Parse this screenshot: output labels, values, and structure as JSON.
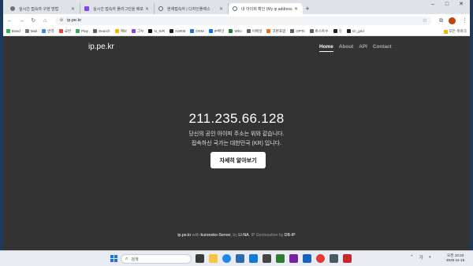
{
  "browser": {
    "tabs": [
      {
        "title": "실시간 접속자 구현 방법",
        "icon": "chrome-icon"
      },
      {
        "title": "실시간 접속자 플러그인을 배포",
        "icon": "purple-app-icon"
      },
      {
        "title": "현재접속자 | 디자인플렉스",
        "icon": "globe-icon"
      },
      {
        "title": "내 아이피 확인 (My ip address",
        "icon": "globe-icon"
      }
    ],
    "new_tab_label": "+",
    "address": "ip.pe.kr",
    "bookmarks": [
      {
        "label": "Band",
        "color": "#2bb24c"
      },
      {
        "label": "Mail",
        "color": "#777777"
      },
      {
        "label": "번역",
        "color": "#4285f4"
      },
      {
        "label": "국번",
        "color": "#ea4335"
      },
      {
        "label": "Play",
        "color": "#34a853"
      },
      {
        "label": "Search",
        "color": "#5f6368"
      },
      {
        "label": "매보",
        "color": "#f4b400"
      },
      {
        "label": "그누",
        "color": "#8a3ffc"
      },
      {
        "label": "N_SIR",
        "color": "#111111"
      },
      {
        "label": "A2008",
        "color": "#222222"
      },
      {
        "label": "DSM",
        "color": "#1a73e8"
      },
      {
        "label": "IP확인",
        "color": "#0d6efd"
      },
      {
        "label": "Who",
        "color": "#188038"
      },
      {
        "label": "이메일",
        "color": "#5f6368"
      },
      {
        "label": "코판포럼",
        "color": "#e8710a"
      },
      {
        "label": "GPTs",
        "color": "#5f6368"
      },
      {
        "label": "토스트수",
        "color": "#5f6368"
      },
      {
        "label": "깃",
        "color": "#202124"
      },
      {
        "label": "GI_grid",
        "color": "#202124"
      }
    ],
    "bookmarks_folder": "모든 북마크"
  },
  "page": {
    "brand": "ip.pe.kr",
    "nav": [
      "Home",
      "About",
      "API",
      "Contact"
    ],
    "ip_address": "211.235.66.128",
    "line1": "당신의 공인 아이피 주소는 위와 같습니다.",
    "line2": "접속하신 국가는 대한민국 (KR) 입니다.",
    "more_button": "자세히 알아보기",
    "footer": {
      "site": "ip.pe.kr",
      "with": " with ",
      "server": "kuroneko-Server",
      "by": ", by ",
      "author": "LI-NA",
      "geo_prefix": ". IP Geolocation by ",
      "geo": "DB-IP"
    }
  },
  "taskbar": {
    "search_placeholder": "검색",
    "tray_lang": "가",
    "time": "오전 10:23",
    "date": "2025-11-15"
  }
}
